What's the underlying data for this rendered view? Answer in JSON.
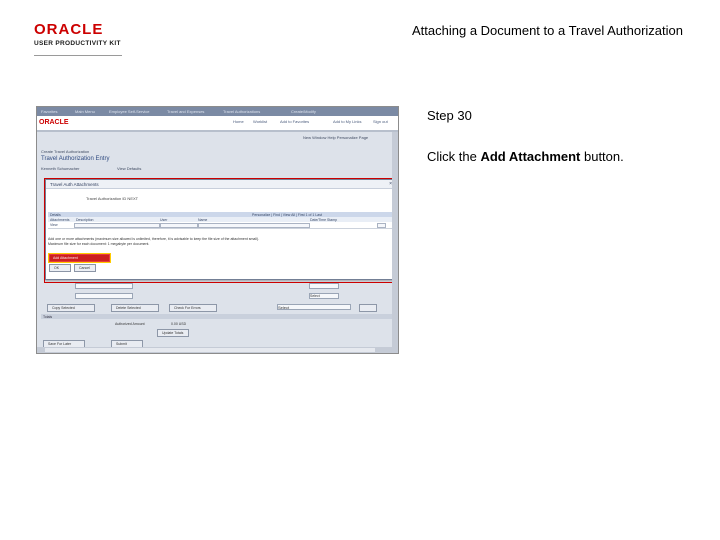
{
  "header": {
    "logo_text": "ORACLE",
    "logo_subtitle": "USER PRODUCTIVITY KIT",
    "doc_title": "Attaching a Document to a Travel Authorization"
  },
  "screenshot": {
    "top_nav": [
      "Favorites",
      "Main Menu",
      "Employee Self-Service",
      "Travel and Expenses",
      "Travel Authorizations",
      "Create/Modify"
    ],
    "logo": "ORACLE",
    "app_nav": [
      "Home",
      "Worklist",
      "Add to Favorites",
      "Add to My Links",
      "Sign out"
    ],
    "page_links": "New Window  Help  Personalize Page",
    "breadcrumb": "Create Travel Authorization",
    "page_title": "Travel Authorization Entry",
    "employee_name": "Kenneth Schumacher",
    "view_defaults": "View Defaults",
    "modal": {
      "title": "Travel Auth Attachments",
      "close_icon": "close-icon",
      "auth_label": "Travel Authorization ID  NEXT",
      "grid_title": "Details",
      "grid_nav": "Personalize | Find | View All |     First  1 of 1  Last",
      "columns": [
        "Attachments",
        "Description",
        "User",
        "Name",
        "Date/Time Stamp"
      ],
      "row_view": "View",
      "note_line1": "Add one or more attachments (maximum size allowed is unlimited, therefore, it is advisable to keep the file size of the attachment small).",
      "note_line2": "Maximum file size for each document: 1 megabyte per document.",
      "add_attachment_label": "Add Attachment",
      "ok_label": "OK",
      "cancel_label": "Cancel"
    },
    "lower": {
      "select_value_1": "Select",
      "select_value_2": "Select",
      "buttons": [
        "Copy Selected",
        "Delete Selected",
        "Check For Errors"
      ],
      "totals_label": "Totals",
      "authorized_amount_label": "Authorized Amount",
      "authorized_amount_value": "0.00  USD",
      "update_totals_label": "Update Totals",
      "save_label": "Save For Later",
      "submit_label": "Submit"
    }
  },
  "instructions": {
    "step": "Step 30",
    "prefix": "Click the ",
    "target": "Add Attachment",
    "suffix": " button."
  }
}
